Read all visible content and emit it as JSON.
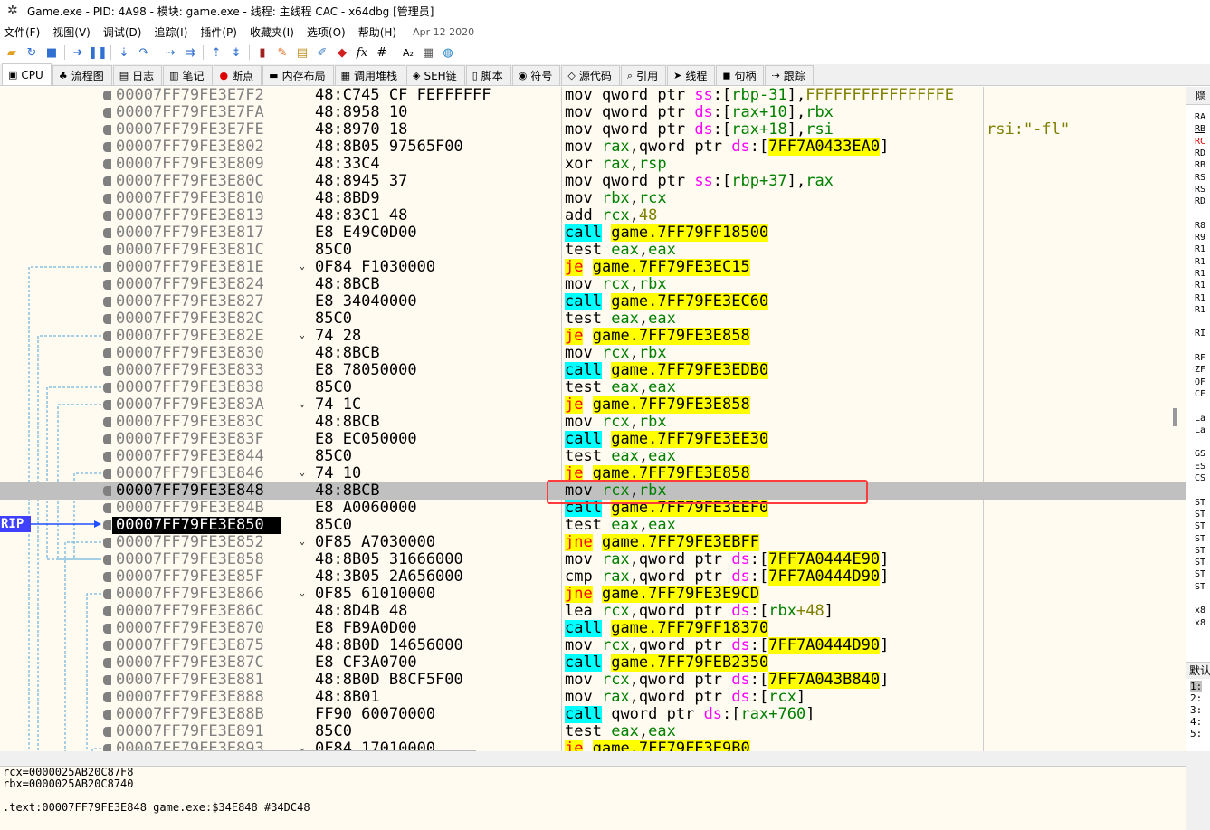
{
  "window": {
    "title": "Game.exe - PID: 4A98 - 模块: game.exe - 线程: 主线程 CAC - x64dbg [管理员]"
  },
  "menu": {
    "items": [
      "文件(F)",
      "视图(V)",
      "调试(D)",
      "追踪(I)",
      "插件(P)",
      "收藏夹(I)",
      "选项(O)",
      "帮助(H)"
    ],
    "date": "Apr 12 2020"
  },
  "toolbar": {
    "icons": [
      "open-icon",
      "restart-icon",
      "stop-icon",
      "run-icon",
      "pause-icon",
      "step-into-icon",
      "step-over-icon",
      "trace-into-icon",
      "trace-over-icon",
      "execute-till-return-icon",
      "run-to-user-code-icon",
      "scylla-icon",
      "patch-icon",
      "comment-icon",
      "label-icon",
      "bookmark-icon",
      "function-icon",
      "hash-icon",
      "font-icon",
      "calculator-icon",
      "globe-icon"
    ],
    "fx": "fx",
    "hash": "#",
    "font": "A₂"
  },
  "tabs": [
    {
      "label": "CPU",
      "active": true
    },
    {
      "label": "流程图"
    },
    {
      "label": "日志"
    },
    {
      "label": "笔记"
    },
    {
      "label": "断点"
    },
    {
      "label": "内存布局"
    },
    {
      "label": "调用堆栈"
    },
    {
      "label": "SEH链"
    },
    {
      "label": "脚本"
    },
    {
      "label": "符号"
    },
    {
      "label": "源代码"
    },
    {
      "label": "引用"
    },
    {
      "label": "线程"
    },
    {
      "label": "句柄"
    },
    {
      "label": "跟踪"
    }
  ],
  "rip_label": "RIP",
  "rows": [
    {
      "addr": "00007FF79FE3E7F2",
      "bytes": "48:C745 CF FEFFFFFF",
      "fold": "",
      "dis": [
        [
          "m",
          "mov "
        ],
        [
          "m",
          "qword ptr "
        ],
        [
          "s",
          "ss"
        ],
        [
          "b",
          ":["
        ],
        [
          "r",
          "rbp-31"
        ],
        [
          "b",
          "]"
        ],
        [
          "b",
          ","
        ],
        [
          "n",
          "FFFFFFFFFFFFFFFE"
        ]
      ]
    },
    {
      "addr": "00007FF79FE3E7FA",
      "bytes": "48:8958 10",
      "fold": "",
      "dis": [
        [
          "m",
          "mov "
        ],
        [
          "m",
          "qword ptr "
        ],
        [
          "s",
          "ds"
        ],
        [
          "b",
          ":["
        ],
        [
          "r",
          "rax+10"
        ],
        [
          "b",
          "]"
        ],
        [
          "b",
          ","
        ],
        [
          "u",
          "rbx"
        ]
      ]
    },
    {
      "addr": "00007FF79FE3E7FE",
      "bytes": "48:8970 18",
      "fold": "",
      "dis": [
        [
          "m",
          "mov "
        ],
        [
          "m",
          "qword ptr "
        ],
        [
          "s",
          "ds"
        ],
        [
          "b",
          ":["
        ],
        [
          "r",
          "rax+18"
        ],
        [
          "b",
          "]"
        ],
        [
          "b",
          ","
        ],
        [
          "r",
          "rsi"
        ]
      ],
      "cmt": "rsi:\"-fl\""
    },
    {
      "addr": "00007FF79FE3E802",
      "bytes": "48:8B05 97565F00",
      "fold": "",
      "dis": [
        [
          "m",
          "mov "
        ],
        [
          "r",
          "rax"
        ],
        [
          "b",
          ","
        ],
        [
          "m",
          "qword ptr "
        ],
        [
          "s",
          "ds"
        ],
        [
          "b",
          ":["
        ],
        [
          "h",
          "7FF7A0433EA0"
        ],
        [
          "b",
          "]"
        ]
      ]
    },
    {
      "addr": "00007FF79FE3E809",
      "bytes": "48:33C4",
      "fold": "",
      "dis": [
        [
          "m",
          "xor "
        ],
        [
          "r",
          "rax"
        ],
        [
          "b",
          ","
        ],
        [
          "r",
          "rsp"
        ]
      ]
    },
    {
      "addr": "00007FF79FE3E80C",
      "bytes": "48:8945 37",
      "fold": "",
      "dis": [
        [
          "m",
          "mov "
        ],
        [
          "m",
          "qword ptr "
        ],
        [
          "s",
          "ss"
        ],
        [
          "b",
          ":["
        ],
        [
          "r",
          "rbp+37"
        ],
        [
          "b",
          "]"
        ],
        [
          "b",
          ","
        ],
        [
          "r",
          "rax"
        ]
      ]
    },
    {
      "addr": "00007FF79FE3E810",
      "bytes": "48:8BD9",
      "fold": "",
      "dis": [
        [
          "m",
          "mov "
        ],
        [
          "u",
          "rbx"
        ],
        [
          "b",
          ","
        ],
        [
          "r",
          "rcx"
        ]
      ]
    },
    {
      "addr": "00007FF79FE3E813",
      "bytes": "48:83C1 48",
      "fold": "",
      "dis": [
        [
          "m",
          "add "
        ],
        [
          "r",
          "rcx"
        ],
        [
          "b",
          ","
        ],
        [
          "n",
          "48"
        ]
      ]
    },
    {
      "addr": "00007FF79FE3E817",
      "bytes": "E8 E49C0D00",
      "fold": "",
      "dis": [
        [
          "c",
          "call"
        ],
        [
          "b",
          " "
        ],
        [
          "h",
          "game.7FF79FF18500"
        ]
      ]
    },
    {
      "addr": "00007FF79FE3E81C",
      "bytes": "85C0",
      "fold": "",
      "dis": [
        [
          "m",
          "test "
        ],
        [
          "r",
          "eax"
        ],
        [
          "b",
          ","
        ],
        [
          "r",
          "eax"
        ]
      ]
    },
    {
      "addr": "00007FF79FE3E81E",
      "bytes": "0F84 F1030000",
      "fold": "⌄",
      "dis": [
        [
          "j",
          "je"
        ],
        [
          "b",
          " "
        ],
        [
          "h",
          "game.7FF79FE3EC15"
        ]
      ]
    },
    {
      "addr": "00007FF79FE3E824",
      "bytes": "48:8BCB",
      "fold": "",
      "dis": [
        [
          "m",
          "mov "
        ],
        [
          "r",
          "rcx"
        ],
        [
          "b",
          ","
        ],
        [
          "u",
          "rbx"
        ]
      ]
    },
    {
      "addr": "00007FF79FE3E827",
      "bytes": "E8 34040000",
      "fold": "",
      "dis": [
        [
          "c",
          "call"
        ],
        [
          "b",
          " "
        ],
        [
          "h",
          "game.7FF79FE3EC60"
        ]
      ]
    },
    {
      "addr": "00007FF79FE3E82C",
      "bytes": "85C0",
      "fold": "",
      "dis": [
        [
          "m",
          "test "
        ],
        [
          "r",
          "eax"
        ],
        [
          "b",
          ","
        ],
        [
          "r",
          "eax"
        ]
      ]
    },
    {
      "addr": "00007FF79FE3E82E",
      "bytes": "74 28",
      "fold": "⌄",
      "dis": [
        [
          "j",
          "je"
        ],
        [
          "b",
          " "
        ],
        [
          "h",
          "game.7FF79FE3E858"
        ]
      ]
    },
    {
      "addr": "00007FF79FE3E830",
      "bytes": "48:8BCB",
      "fold": "",
      "dis": [
        [
          "m",
          "mov "
        ],
        [
          "r",
          "rcx"
        ],
        [
          "b",
          ","
        ],
        [
          "u",
          "rbx"
        ]
      ]
    },
    {
      "addr": "00007FF79FE3E833",
      "bytes": "E8 78050000",
      "fold": "",
      "dis": [
        [
          "c",
          "call"
        ],
        [
          "b",
          " "
        ],
        [
          "h",
          "game.7FF79FE3EDB0"
        ]
      ]
    },
    {
      "addr": "00007FF79FE3E838",
      "bytes": "85C0",
      "fold": "",
      "dis": [
        [
          "m",
          "test "
        ],
        [
          "r",
          "eax"
        ],
        [
          "b",
          ","
        ],
        [
          "r",
          "eax"
        ]
      ]
    },
    {
      "addr": "00007FF79FE3E83A",
      "bytes": "74 1C",
      "fold": "⌄",
      "dis": [
        [
          "j",
          "je"
        ],
        [
          "b",
          " "
        ],
        [
          "h",
          "game.7FF79FE3E858"
        ]
      ]
    },
    {
      "addr": "00007FF79FE3E83C",
      "bytes": "48:8BCB",
      "fold": "",
      "dis": [
        [
          "m",
          "mov "
        ],
        [
          "r",
          "rcx"
        ],
        [
          "b",
          ","
        ],
        [
          "u",
          "rbx"
        ]
      ]
    },
    {
      "addr": "00007FF79FE3E83F",
      "bytes": "E8 EC050000",
      "fold": "",
      "dis": [
        [
          "c",
          "call"
        ],
        [
          "b",
          " "
        ],
        [
          "h",
          "game.7FF79FE3EE30"
        ]
      ]
    },
    {
      "addr": "00007FF79FE3E844",
      "bytes": "85C0",
      "fold": "",
      "dis": [
        [
          "m",
          "test "
        ],
        [
          "r",
          "eax"
        ],
        [
          "b",
          ","
        ],
        [
          "r",
          "eax"
        ]
      ]
    },
    {
      "addr": "00007FF79FE3E846",
      "bytes": "74 10",
      "fold": "⌄",
      "dis": [
        [
          "j",
          "je"
        ],
        [
          "b",
          " "
        ],
        [
          "h",
          "game.7FF79FE3E858"
        ]
      ]
    },
    {
      "addr": "00007FF79FE3E848",
      "bytes": "48:8BCB",
      "fold": "",
      "sel": true,
      "dis": [
        [
          "m",
          "mov "
        ],
        [
          "r",
          "rcx"
        ],
        [
          "b",
          ","
        ],
        [
          "u",
          "rbx"
        ]
      ]
    },
    {
      "addr": "00007FF79FE3E84B",
      "bytes": "E8 A0060000",
      "fold": "",
      "dis": [
        [
          "c",
          "call"
        ],
        [
          "b",
          " "
        ],
        [
          "h",
          "game.7FF79FE3EEF0"
        ]
      ]
    },
    {
      "addr": "00007FF79FE3E850",
      "bytes": "85C0",
      "fold": "",
      "rip": true,
      "dis": [
        [
          "m",
          "test "
        ],
        [
          "r",
          "eax"
        ],
        [
          "b",
          ","
        ],
        [
          "r",
          "eax"
        ]
      ]
    },
    {
      "addr": "00007FF79FE3E852",
      "bytes": "0F85 A7030000",
      "fold": "⌄",
      "dis": [
        [
          "j",
          "jne"
        ],
        [
          "b",
          " "
        ],
        [
          "h",
          "game.7FF79FE3EBFF"
        ]
      ]
    },
    {
      "addr": "00007FF79FE3E858",
      "bytes": "48:8B05 31666000",
      "fold": "",
      "dis": [
        [
          "m",
          "mov "
        ],
        [
          "r",
          "rax"
        ],
        [
          "b",
          ","
        ],
        [
          "m",
          "qword ptr "
        ],
        [
          "s",
          "ds"
        ],
        [
          "b",
          ":["
        ],
        [
          "h",
          "7FF7A0444E90"
        ],
        [
          "b",
          "]"
        ]
      ]
    },
    {
      "addr": "00007FF79FE3E85F",
      "bytes": "48:3B05 2A656000",
      "fold": "",
      "dis": [
        [
          "m",
          "cmp "
        ],
        [
          "r",
          "rax"
        ],
        [
          "b",
          ","
        ],
        [
          "m",
          "qword ptr "
        ],
        [
          "s",
          "ds"
        ],
        [
          "b",
          ":["
        ],
        [
          "h",
          "7FF7A0444D90"
        ],
        [
          "b",
          "]"
        ]
      ]
    },
    {
      "addr": "00007FF79FE3E866",
      "bytes": "0F85 61010000",
      "fold": "⌄",
      "dis": [
        [
          "j",
          "jne"
        ],
        [
          "b",
          " "
        ],
        [
          "h",
          "game.7FF79FE3E9CD"
        ]
      ]
    },
    {
      "addr": "00007FF79FE3E86C",
      "bytes": "48:8D4B 48",
      "fold": "",
      "dis": [
        [
          "m",
          "lea "
        ],
        [
          "r",
          "rcx"
        ],
        [
          "b",
          ","
        ],
        [
          "m",
          "qword ptr "
        ],
        [
          "s",
          "ds"
        ],
        [
          "b",
          ":["
        ],
        [
          "u",
          "rbx"
        ],
        [
          "n",
          "+48"
        ],
        [
          "b",
          "]"
        ]
      ]
    },
    {
      "addr": "00007FF79FE3E870",
      "bytes": "E8 FB9A0D00",
      "fold": "",
      "dis": [
        [
          "c",
          "call"
        ],
        [
          "b",
          " "
        ],
        [
          "h",
          "game.7FF79FF18370"
        ]
      ]
    },
    {
      "addr": "00007FF79FE3E875",
      "bytes": "48:8B0D 14656000",
      "fold": "",
      "dis": [
        [
          "m",
          "mov "
        ],
        [
          "r",
          "rcx"
        ],
        [
          "b",
          ","
        ],
        [
          "m",
          "qword ptr "
        ],
        [
          "s",
          "ds"
        ],
        [
          "b",
          ":["
        ],
        [
          "h",
          "7FF7A0444D90"
        ],
        [
          "b",
          "]"
        ]
      ]
    },
    {
      "addr": "00007FF79FE3E87C",
      "bytes": "E8 CF3A0700",
      "fold": "",
      "dis": [
        [
          "c",
          "call"
        ],
        [
          "b",
          " "
        ],
        [
          "h",
          "game.7FF79FEB2350"
        ]
      ]
    },
    {
      "addr": "00007FF79FE3E881",
      "bytes": "48:8B0D B8CF5F00",
      "fold": "",
      "dis": [
        [
          "m",
          "mov "
        ],
        [
          "r",
          "rcx"
        ],
        [
          "b",
          ","
        ],
        [
          "m",
          "qword ptr "
        ],
        [
          "s",
          "ds"
        ],
        [
          "b",
          ":["
        ],
        [
          "h",
          "7FF7A043B840"
        ],
        [
          "b",
          "]"
        ]
      ]
    },
    {
      "addr": "00007FF79FE3E888",
      "bytes": "48:8B01",
      "fold": "",
      "dis": [
        [
          "m",
          "mov "
        ],
        [
          "r",
          "rax"
        ],
        [
          "b",
          ","
        ],
        [
          "m",
          "qword ptr "
        ],
        [
          "s",
          "ds"
        ],
        [
          "b",
          ":["
        ],
        [
          "r",
          "rcx"
        ],
        [
          "b",
          "]"
        ]
      ]
    },
    {
      "addr": "00007FF79FE3E88B",
      "bytes": "FF90 60070000",
      "fold": "",
      "dis": [
        [
          "c",
          "call"
        ],
        [
          "b",
          " "
        ],
        [
          "m",
          "qword ptr "
        ],
        [
          "s",
          "ds"
        ],
        [
          "b",
          ":["
        ],
        [
          "r",
          "rax+760"
        ],
        [
          "b",
          "]"
        ]
      ]
    },
    {
      "addr": "00007FF79FE3E891",
      "bytes": "85C0",
      "fold": "",
      "dis": [
        [
          "m",
          "test "
        ],
        [
          "r",
          "eax"
        ],
        [
          "b",
          ","
        ],
        [
          "r",
          "eax"
        ]
      ]
    },
    {
      "addr": "00007FF79FE3E893",
      "bytes": "0F84 17010000",
      "fold": "⌄",
      "dis": [
        [
          "j",
          "je"
        ],
        [
          "b",
          " "
        ],
        [
          "h",
          "game.7FF79FE3E9B0"
        ]
      ]
    }
  ],
  "right_panel": {
    "header": "隐",
    "regs": [
      "RA",
      "RB",
      "RC",
      "RD",
      "RB",
      "RS",
      "RS",
      "RD",
      "",
      "R8",
      "R9",
      "R1",
      "R1",
      "R1",
      "R1",
      "R1",
      "R1",
      "",
      "RI",
      "",
      "RF",
      "ZF",
      "OF",
      "CF",
      "",
      "La",
      "La",
      "",
      "GS",
      "ES",
      "CS",
      "",
      "ST",
      "ST",
      "ST",
      "ST",
      "ST",
      "ST",
      "ST",
      "ST",
      "",
      "x8",
      "x8"
    ],
    "stack_header": "默认",
    "stack_rows": [
      "1:",
      "2:",
      "3:",
      "4:",
      "5:"
    ]
  },
  "info": {
    "line1": "rcx=0000025AB20C87F8",
    "line2": "rbx=0000025AB20C8740",
    "line3": ".text:00007FF79FE3E848 game.exe:$34E848 #34DC48"
  }
}
